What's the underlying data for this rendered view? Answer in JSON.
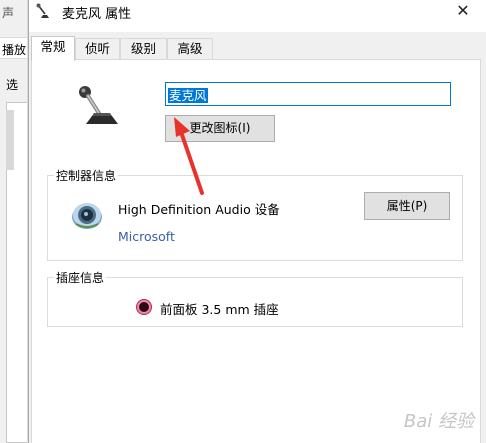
{
  "background_window": {
    "title_glyph": "声",
    "tab_label": "播放",
    "label": "选"
  },
  "dialog": {
    "title": "麦克风 属性",
    "close_glyph": "✕"
  },
  "tabs": [
    {
      "label": "常规",
      "active": true
    },
    {
      "label": "侦听",
      "active": false
    },
    {
      "label": "级别",
      "active": false
    },
    {
      "label": "高级",
      "active": false
    }
  ],
  "general": {
    "device_name_value": "麦克风",
    "change_icon_label": "更改图标(I)",
    "controller_group_label": "控制器信息",
    "controller_name": "High Definition Audio 设备",
    "controller_vendor": "Microsoft",
    "properties_label": "属性(P)",
    "jack_group_label": "插座信息",
    "jack_label": "前面板 3.5 mm 插座"
  },
  "icons": {
    "title": "microphone-icon",
    "device": "microphone-icon",
    "controller": "speaker-icon",
    "jack": "audio-jack-icon",
    "close": "close-icon"
  },
  "watermark": "Bai 经验",
  "colors": {
    "accent": "#0078d7",
    "link": "#3a5fa9",
    "annotation_arrow": "#e8332c",
    "jack_ring": "#f08aa8"
  }
}
